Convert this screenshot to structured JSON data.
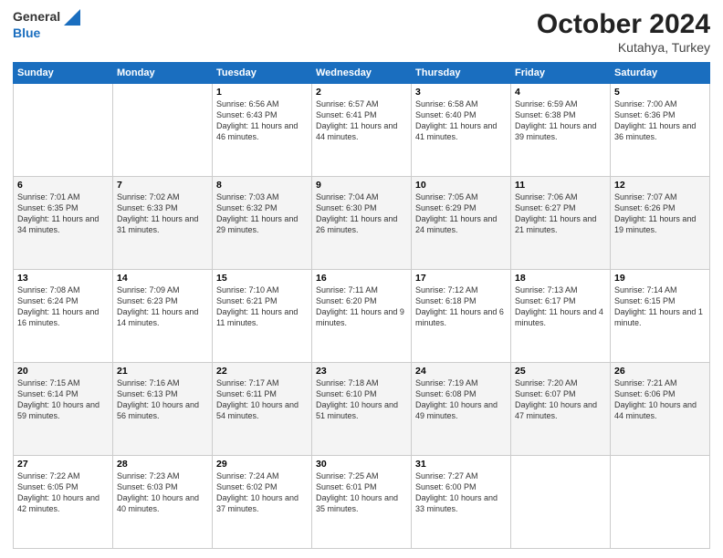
{
  "logo": {
    "line1": "General",
    "line2": "Blue"
  },
  "header": {
    "month_year": "October 2024",
    "location": "Kutahya, Turkey"
  },
  "days_of_week": [
    "Sunday",
    "Monday",
    "Tuesday",
    "Wednesday",
    "Thursday",
    "Friday",
    "Saturday"
  ],
  "weeks": [
    [
      {
        "num": "",
        "sunrise": "",
        "sunset": "",
        "daylight": ""
      },
      {
        "num": "",
        "sunrise": "",
        "sunset": "",
        "daylight": ""
      },
      {
        "num": "1",
        "sunrise": "Sunrise: 6:56 AM",
        "sunset": "Sunset: 6:43 PM",
        "daylight": "Daylight: 11 hours and 46 minutes."
      },
      {
        "num": "2",
        "sunrise": "Sunrise: 6:57 AM",
        "sunset": "Sunset: 6:41 PM",
        "daylight": "Daylight: 11 hours and 44 minutes."
      },
      {
        "num": "3",
        "sunrise": "Sunrise: 6:58 AM",
        "sunset": "Sunset: 6:40 PM",
        "daylight": "Daylight: 11 hours and 41 minutes."
      },
      {
        "num": "4",
        "sunrise": "Sunrise: 6:59 AM",
        "sunset": "Sunset: 6:38 PM",
        "daylight": "Daylight: 11 hours and 39 minutes."
      },
      {
        "num": "5",
        "sunrise": "Sunrise: 7:00 AM",
        "sunset": "Sunset: 6:36 PM",
        "daylight": "Daylight: 11 hours and 36 minutes."
      }
    ],
    [
      {
        "num": "6",
        "sunrise": "Sunrise: 7:01 AM",
        "sunset": "Sunset: 6:35 PM",
        "daylight": "Daylight: 11 hours and 34 minutes."
      },
      {
        "num": "7",
        "sunrise": "Sunrise: 7:02 AM",
        "sunset": "Sunset: 6:33 PM",
        "daylight": "Daylight: 11 hours and 31 minutes."
      },
      {
        "num": "8",
        "sunrise": "Sunrise: 7:03 AM",
        "sunset": "Sunset: 6:32 PM",
        "daylight": "Daylight: 11 hours and 29 minutes."
      },
      {
        "num": "9",
        "sunrise": "Sunrise: 7:04 AM",
        "sunset": "Sunset: 6:30 PM",
        "daylight": "Daylight: 11 hours and 26 minutes."
      },
      {
        "num": "10",
        "sunrise": "Sunrise: 7:05 AM",
        "sunset": "Sunset: 6:29 PM",
        "daylight": "Daylight: 11 hours and 24 minutes."
      },
      {
        "num": "11",
        "sunrise": "Sunrise: 7:06 AM",
        "sunset": "Sunset: 6:27 PM",
        "daylight": "Daylight: 11 hours and 21 minutes."
      },
      {
        "num": "12",
        "sunrise": "Sunrise: 7:07 AM",
        "sunset": "Sunset: 6:26 PM",
        "daylight": "Daylight: 11 hours and 19 minutes."
      }
    ],
    [
      {
        "num": "13",
        "sunrise": "Sunrise: 7:08 AM",
        "sunset": "Sunset: 6:24 PM",
        "daylight": "Daylight: 11 hours and 16 minutes."
      },
      {
        "num": "14",
        "sunrise": "Sunrise: 7:09 AM",
        "sunset": "Sunset: 6:23 PM",
        "daylight": "Daylight: 11 hours and 14 minutes."
      },
      {
        "num": "15",
        "sunrise": "Sunrise: 7:10 AM",
        "sunset": "Sunset: 6:21 PM",
        "daylight": "Daylight: 11 hours and 11 minutes."
      },
      {
        "num": "16",
        "sunrise": "Sunrise: 7:11 AM",
        "sunset": "Sunset: 6:20 PM",
        "daylight": "Daylight: 11 hours and 9 minutes."
      },
      {
        "num": "17",
        "sunrise": "Sunrise: 7:12 AM",
        "sunset": "Sunset: 6:18 PM",
        "daylight": "Daylight: 11 hours and 6 minutes."
      },
      {
        "num": "18",
        "sunrise": "Sunrise: 7:13 AM",
        "sunset": "Sunset: 6:17 PM",
        "daylight": "Daylight: 11 hours and 4 minutes."
      },
      {
        "num": "19",
        "sunrise": "Sunrise: 7:14 AM",
        "sunset": "Sunset: 6:15 PM",
        "daylight": "Daylight: 11 hours and 1 minute."
      }
    ],
    [
      {
        "num": "20",
        "sunrise": "Sunrise: 7:15 AM",
        "sunset": "Sunset: 6:14 PM",
        "daylight": "Daylight: 10 hours and 59 minutes."
      },
      {
        "num": "21",
        "sunrise": "Sunrise: 7:16 AM",
        "sunset": "Sunset: 6:13 PM",
        "daylight": "Daylight: 10 hours and 56 minutes."
      },
      {
        "num": "22",
        "sunrise": "Sunrise: 7:17 AM",
        "sunset": "Sunset: 6:11 PM",
        "daylight": "Daylight: 10 hours and 54 minutes."
      },
      {
        "num": "23",
        "sunrise": "Sunrise: 7:18 AM",
        "sunset": "Sunset: 6:10 PM",
        "daylight": "Daylight: 10 hours and 51 minutes."
      },
      {
        "num": "24",
        "sunrise": "Sunrise: 7:19 AM",
        "sunset": "Sunset: 6:08 PM",
        "daylight": "Daylight: 10 hours and 49 minutes."
      },
      {
        "num": "25",
        "sunrise": "Sunrise: 7:20 AM",
        "sunset": "Sunset: 6:07 PM",
        "daylight": "Daylight: 10 hours and 47 minutes."
      },
      {
        "num": "26",
        "sunrise": "Sunrise: 7:21 AM",
        "sunset": "Sunset: 6:06 PM",
        "daylight": "Daylight: 10 hours and 44 minutes."
      }
    ],
    [
      {
        "num": "27",
        "sunrise": "Sunrise: 7:22 AM",
        "sunset": "Sunset: 6:05 PM",
        "daylight": "Daylight: 10 hours and 42 minutes."
      },
      {
        "num": "28",
        "sunrise": "Sunrise: 7:23 AM",
        "sunset": "Sunset: 6:03 PM",
        "daylight": "Daylight: 10 hours and 40 minutes."
      },
      {
        "num": "29",
        "sunrise": "Sunrise: 7:24 AM",
        "sunset": "Sunset: 6:02 PM",
        "daylight": "Daylight: 10 hours and 37 minutes."
      },
      {
        "num": "30",
        "sunrise": "Sunrise: 7:25 AM",
        "sunset": "Sunset: 6:01 PM",
        "daylight": "Daylight: 10 hours and 35 minutes."
      },
      {
        "num": "31",
        "sunrise": "Sunrise: 7:27 AM",
        "sunset": "Sunset: 6:00 PM",
        "daylight": "Daylight: 10 hours and 33 minutes."
      },
      {
        "num": "",
        "sunrise": "",
        "sunset": "",
        "daylight": ""
      },
      {
        "num": "",
        "sunrise": "",
        "sunset": "",
        "daylight": ""
      }
    ]
  ]
}
